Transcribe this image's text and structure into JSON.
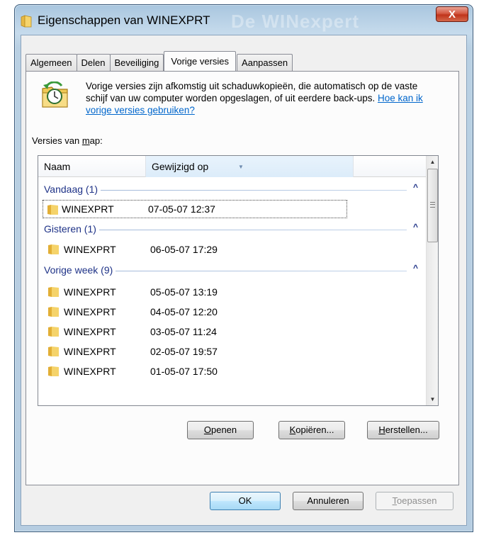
{
  "window": {
    "title": "Eigenschappen van WINEXPRT",
    "title_ghost": "De WINexpert",
    "close_label": "X"
  },
  "tabs": [
    {
      "label": "Algemeen",
      "active": false
    },
    {
      "label": "Delen",
      "active": false
    },
    {
      "label": "Beveiliging",
      "active": false
    },
    {
      "label": "Vorige versies",
      "active": true
    },
    {
      "label": "Aanpassen",
      "active": false
    }
  ],
  "info": {
    "icon": "previous-versions-folder-clock-icon",
    "text": "Vorige versies zijn afkomstig uit schaduwkopieën, die automatisch op de vaste schijf van uw computer worden opgeslagen, of uit eerdere back-ups. ",
    "link_text": "Hoe kan ik vorige versies gebruiken?"
  },
  "versions_label": {
    "before": "Versies van ",
    "underlined": "m",
    "after": "ap:"
  },
  "list": {
    "columns": [
      "Naam",
      "Gewijzigd op"
    ],
    "groups": [
      {
        "label": "Vandaag (1)",
        "items": [
          {
            "name": "WINEXPRT",
            "date": "07-05-07 12:37",
            "selected": true
          }
        ]
      },
      {
        "label": "Gisteren (1)",
        "items": [
          {
            "name": "WINEXPRT",
            "date": "06-05-07 17:29"
          }
        ]
      },
      {
        "label": "Vorige week (9)",
        "items": [
          {
            "name": "WINEXPRT",
            "date": "05-05-07 13:19"
          },
          {
            "name": "WINEXPRT",
            "date": "04-05-07 12:20"
          },
          {
            "name": "WINEXPRT",
            "date": "03-05-07 11:24"
          },
          {
            "name": "WINEXPRT",
            "date": "02-05-07 19:57"
          },
          {
            "name": "WINEXPRT",
            "date": "01-05-07 17:50"
          }
        ]
      }
    ],
    "chevron": "^"
  },
  "actions": {
    "open": {
      "u": "O",
      "rest": "penen"
    },
    "copy": {
      "u": "K",
      "rest": "opiëren..."
    },
    "restore": {
      "u": "H",
      "rest": "erstellen..."
    }
  },
  "footer": {
    "ok": "OK",
    "cancel": "Annuleren",
    "apply": {
      "u": "T",
      "rest": "oepassen"
    }
  },
  "colors": {
    "group_text": "#1e3287",
    "link": "#0066cc",
    "default_button": "#bee6fd"
  }
}
